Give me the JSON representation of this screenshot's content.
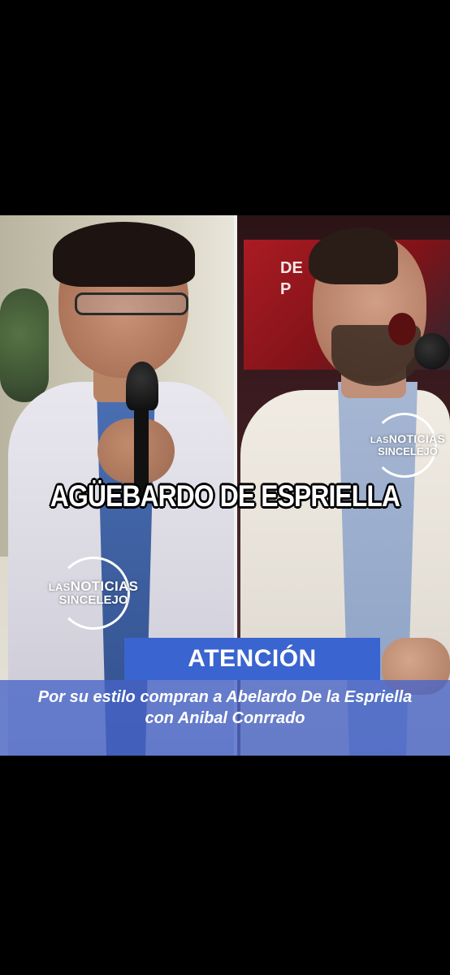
{
  "headline": "AGÜEBARDO DE ESPRIELLA",
  "watermark": {
    "line1_prefix": "LAS",
    "line1_main": "NOTICIAS",
    "line2": "SINCELEJO"
  },
  "banner": {
    "title": "ATENCIÓN",
    "caption_line1": "Por su estilo compran a Abelardo De la Espriella",
    "caption_line2": "con Anibal Conrrado"
  },
  "background_sign": {
    "line1": "DE",
    "line2": "P"
  },
  "colors": {
    "page_background": "#000000",
    "banner_blue": "#3a64cf",
    "caption_band": "#4664c8",
    "headline_text": "#ffffff"
  }
}
